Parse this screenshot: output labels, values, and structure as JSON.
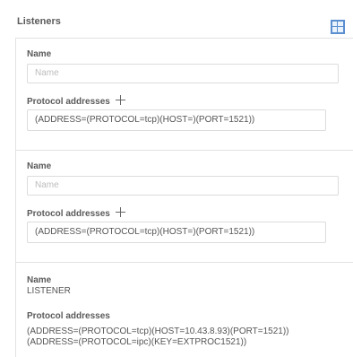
{
  "section": {
    "title": "Listeners"
  },
  "layout_toggle_icon": "grid-layout-icon",
  "listeners": [
    {
      "name_label": "Name",
      "name_placeholder": "Name",
      "protocol_label": "Protocol addresses",
      "address": "(ADDRESS=(PROTOCOL=tcp)(HOST=)(PORT=1521))"
    },
    {
      "name_label": "Name",
      "name_placeholder": "Name",
      "protocol_label": "Protocol addresses",
      "address": "(ADDRESS=(PROTOCOL=tcp)(HOST=)(PORT=1521))"
    },
    {
      "name_label": "Name",
      "name_value": "LISTENER",
      "protocol_label": "Protocol addresses",
      "addresses": [
        "(ADDRESS=(PROTOCOL=tcp)(HOST=10.43.8.93)(PORT=1521))",
        "(ADDRESS=(PROTOCOL=ipc)(KEY=EXTPROC1521))"
      ]
    }
  ]
}
